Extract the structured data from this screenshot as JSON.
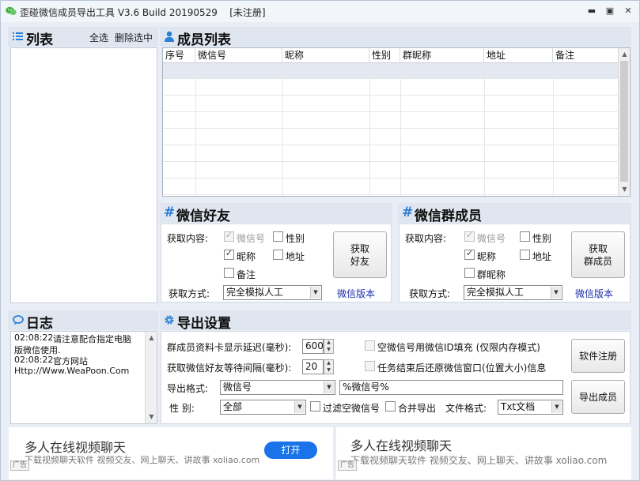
{
  "window": {
    "title": "歪碰微信成员导出工具 V3.6 Build 20190529",
    "status": "[未注册]",
    "controls": [
      "minimize",
      "restore",
      "close"
    ]
  },
  "list_panel": {
    "title": "列表",
    "select_all": "全选",
    "delete_selected": "删除选中"
  },
  "member_panel": {
    "title": "成员列表",
    "columns": [
      "序号",
      "微信号",
      "昵称",
      "性别",
      "群昵称",
      "地址",
      "备注"
    ]
  },
  "friends_panel": {
    "title": "微信好友",
    "fetch_content_label": "获取内容:",
    "options": {
      "wechat_id": "微信号",
      "gender": "性别",
      "nickname": "昵称",
      "address": "地址",
      "remark": "备注"
    },
    "fetch_button": "获取\n好友",
    "fetch_mode_label": "获取方式:",
    "fetch_mode_value": "完全模拟人工",
    "version_link": "微信版本"
  },
  "group_panel": {
    "title": "微信群成员",
    "fetch_content_label": "获取内容:",
    "options": {
      "wechat_id": "微信号",
      "gender": "性别",
      "nickname": "昵称",
      "address": "地址",
      "group_nickname": "群昵称"
    },
    "fetch_button": "获取\n群成员",
    "fetch_mode_label": "获取方式:",
    "fetch_mode_value": "完全模拟人工",
    "version_link": "微信版本"
  },
  "log_panel": {
    "title": "日志",
    "entries": [
      {
        "time": "02:08:22",
        "text": "请注意配合指定电脑"
      },
      {
        "time": "",
        "text": "版微信使用."
      },
      {
        "time": "02:08:22",
        "text": "官方网站"
      },
      {
        "time": "",
        "text": "Http://Www.WeaPoon.Com"
      }
    ]
  },
  "export_panel": {
    "title": "导出设置",
    "card_delay_label": "群成员资料卡显示延迟(毫秒):",
    "card_delay_value": "600",
    "friend_wait_label": "获取微信好友等待间隔(毫秒):",
    "friend_wait_value": "20",
    "fill_empty_label": "空微信号用微信ID填充 (仅限内存模式)",
    "restore_window_label": "任务结束后还原微信窗口(位置大小)信息",
    "export_format_label": "导出格式:",
    "export_format_value": "微信号",
    "export_template_value": "%微信号%",
    "gender_label": "性 别:",
    "gender_value": "全部",
    "filter_empty_label": "过滤空微信号",
    "merge_export_label": "合并导出",
    "file_format_label": "文件格式:",
    "file_format_value": "Txt文档",
    "register_button": "软件注册",
    "export_button": "导出成员"
  },
  "ads": [
    {
      "title": "多人在线视频聊天",
      "subtitle": "下载视频聊天软件 视频交友、网上聊天、讲故事 xoliao.com",
      "tag": "广告",
      "button": "打开"
    },
    {
      "title": "多人在线视频聊天",
      "subtitle": "下载视频聊天软件 视频交友、网上聊天、讲故事 xoliao.com",
      "tag": "广告"
    }
  ],
  "colors": {
    "accent_blue": "#1a73e8",
    "link_blue": "#1f2fa8",
    "panel_header": "#dfe6f0",
    "window_bg": "#e9eef6"
  }
}
